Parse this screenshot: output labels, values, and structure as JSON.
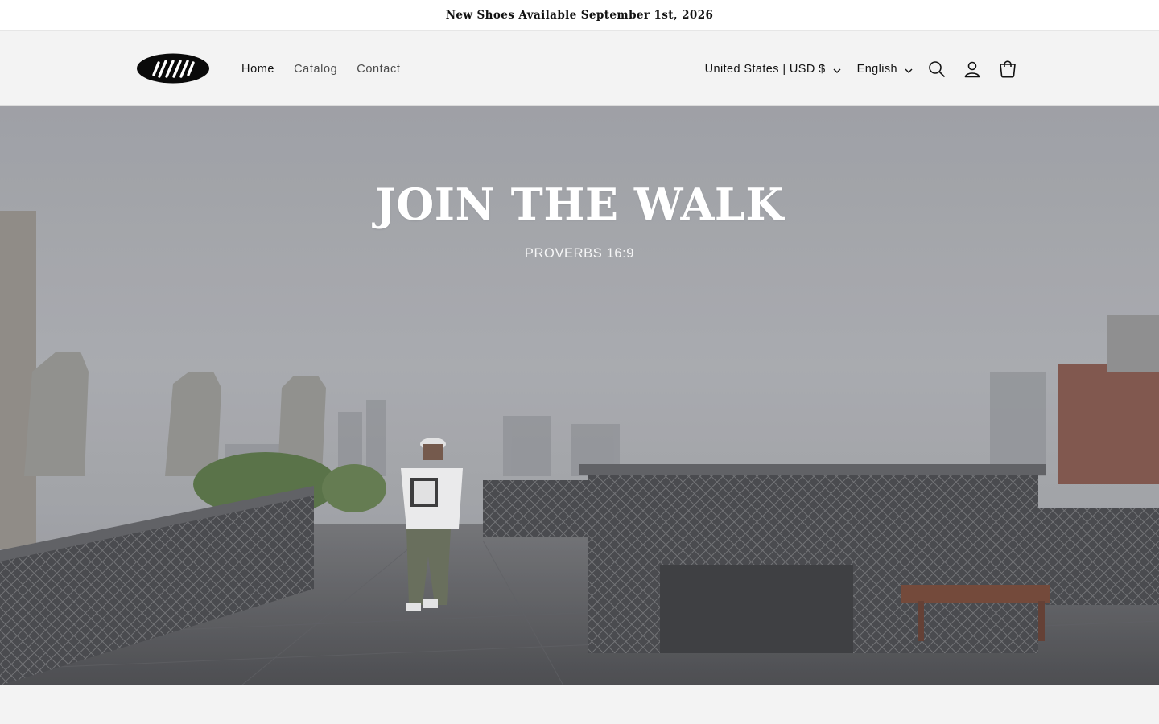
{
  "announcement": {
    "text": "New Shoes Available September 1st, 2026"
  },
  "header": {
    "logo_icon": "brand-logo-icon",
    "nav": [
      {
        "label": "Home",
        "active": true
      },
      {
        "label": "Catalog",
        "active": false
      },
      {
        "label": "Contact",
        "active": false
      }
    ],
    "country_selector": "United States | USD $",
    "language_selector": "English",
    "icons": [
      "search-icon",
      "account-icon",
      "cart-icon"
    ]
  },
  "hero": {
    "title": "JOIN THE WALK",
    "subtitle": "PROVERBS 16:9"
  },
  "colors": {
    "background": "#f3f3f3",
    "text": "#121212",
    "hero_text": "#ffffff"
  }
}
